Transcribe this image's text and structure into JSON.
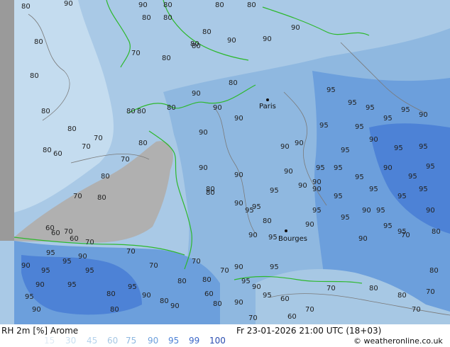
{
  "map": {
    "cities": [
      "Paris",
      "Bourges"
    ],
    "contour_labels": {
      "sea_west": [
        "80",
        "80",
        "80",
        "80",
        "80",
        "80",
        "60",
        "70",
        "70",
        "80",
        "70",
        "80",
        "60",
        "60",
        "70",
        "60",
        "70",
        "70",
        "80"
      ],
      "land_north": [
        "90",
        "90",
        "80",
        "80",
        "80",
        "80",
        "80",
        "80",
        "80",
        "80",
        "80",
        "70",
        "80",
        "90",
        "90",
        "80",
        "80",
        "80",
        "90",
        "90",
        "90"
      ],
      "land_center": [
        "90",
        "90",
        "90",
        "90",
        "90",
        "90",
        "95",
        "90",
        "95",
        "95",
        "90",
        "90",
        "95",
        "95",
        "90",
        "80",
        "80",
        "90",
        "80",
        "90"
      ],
      "land_east": [
        "95",
        "95",
        "95",
        "95",
        "95",
        "90",
        "95",
        "90",
        "95",
        "95",
        "95",
        "95",
        "95",
        "90",
        "95",
        "95",
        "95",
        "90",
        "95",
        "95",
        "95",
        "90",
        "95",
        "90",
        "95",
        "95",
        "90",
        "95",
        "95",
        "95"
      ],
      "land_south": [
        "90",
        "95",
        "95",
        "90",
        "95",
        "90",
        "95",
        "80",
        "95",
        "90",
        "70",
        "95",
        "95",
        "90",
        "80",
        "80",
        "70",
        "80",
        "60",
        "70",
        "90",
        "95",
        "90",
        "95",
        "95",
        "90",
        "80",
        "90",
        "70",
        "80"
      ],
      "mediterranean": [
        "70",
        "80",
        "80",
        "70",
        "80",
        "70",
        "80",
        "70",
        "60",
        "70",
        "60",
        "70"
      ]
    },
    "colors": {
      "sea_dark": "#a9c9e6",
      "level_30": "#c8dff0",
      "level_60": "#a7c8e4",
      "level_75": "#8fb8e0",
      "level_90": "#6c9fdc",
      "level_95": "#4d82d6",
      "level_99": "#3a66c8",
      "land_dry": "#b0b0b0",
      "coast": "#2db82d",
      "contour": "#7a7a7a"
    }
  },
  "footer": {
    "product": "RH 2m [%] Arome",
    "datetime": "Fr 23-01-2026 21:00 UTC (18+03)",
    "credit": "© weatheronline.co.uk",
    "scale_values": [
      "15",
      "30",
      "45",
      "60",
      "75",
      "90",
      "95",
      "99",
      "100"
    ],
    "scale_colors": [
      "#dfeaf4",
      "#c8dff0",
      "#b6d3ec",
      "#a7c8e4",
      "#8fb8e0",
      "#6c9fdc",
      "#4d82d6",
      "#3a66c8",
      "#2a4cb0"
    ]
  }
}
